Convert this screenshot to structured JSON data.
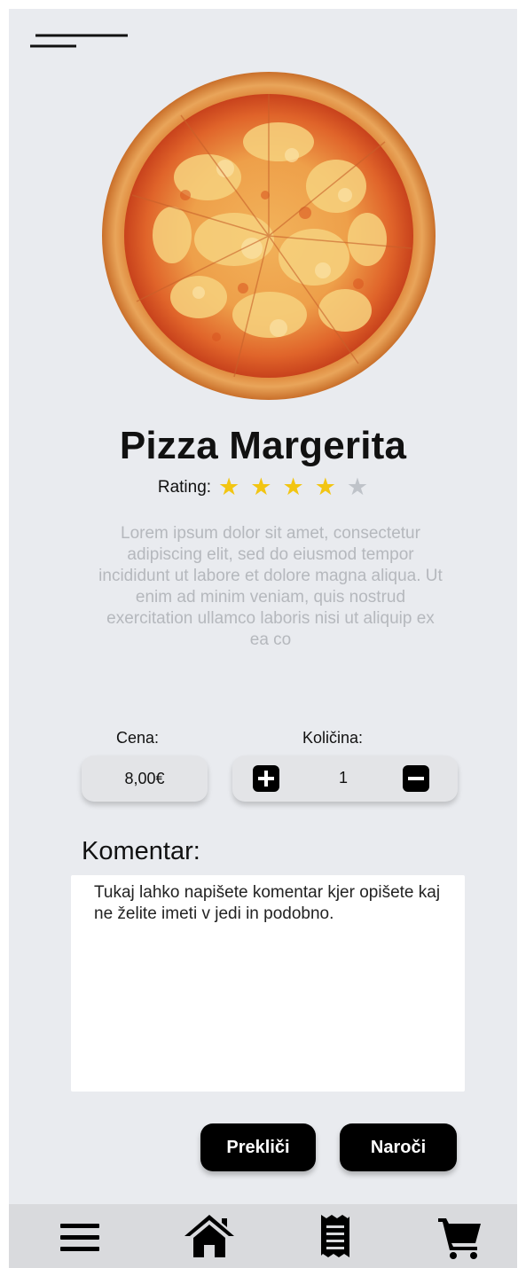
{
  "product": {
    "title": "Pizza Margerita",
    "rating_label": "Rating:",
    "rating_value": 4,
    "rating_max": 5,
    "description": "Lorem ipsum dolor sit amet, consectetur adipiscing elit, sed do eiusmod tempor incididunt ut labore et dolore magna aliqua. Ut enim ad minim veniam, quis nostrud exercitation ullamco laboris nisi ut aliquip ex ea co"
  },
  "price": {
    "label": "Cena:",
    "value": "8,00€"
  },
  "quantity": {
    "label": "Količina:",
    "value": "1"
  },
  "comment": {
    "label": "Komentar:",
    "value": "Tukaj lahko napišete komentar kjer opišete kaj ne želite imeti v jedi in podobno."
  },
  "actions": {
    "cancel_label": "Prekliči",
    "order_label": "Naroči"
  },
  "bottom_nav": {
    "items": [
      {
        "icon": "menu-icon"
      },
      {
        "icon": "home-icon"
      },
      {
        "icon": "receipt-icon"
      },
      {
        "icon": "cart-icon"
      }
    ]
  },
  "colors": {
    "background": "#e9ebef",
    "star_active": "#f2c512",
    "star_inactive": "#bfc3c9",
    "button": "#000000",
    "nav_bar": "#d9dadd"
  }
}
